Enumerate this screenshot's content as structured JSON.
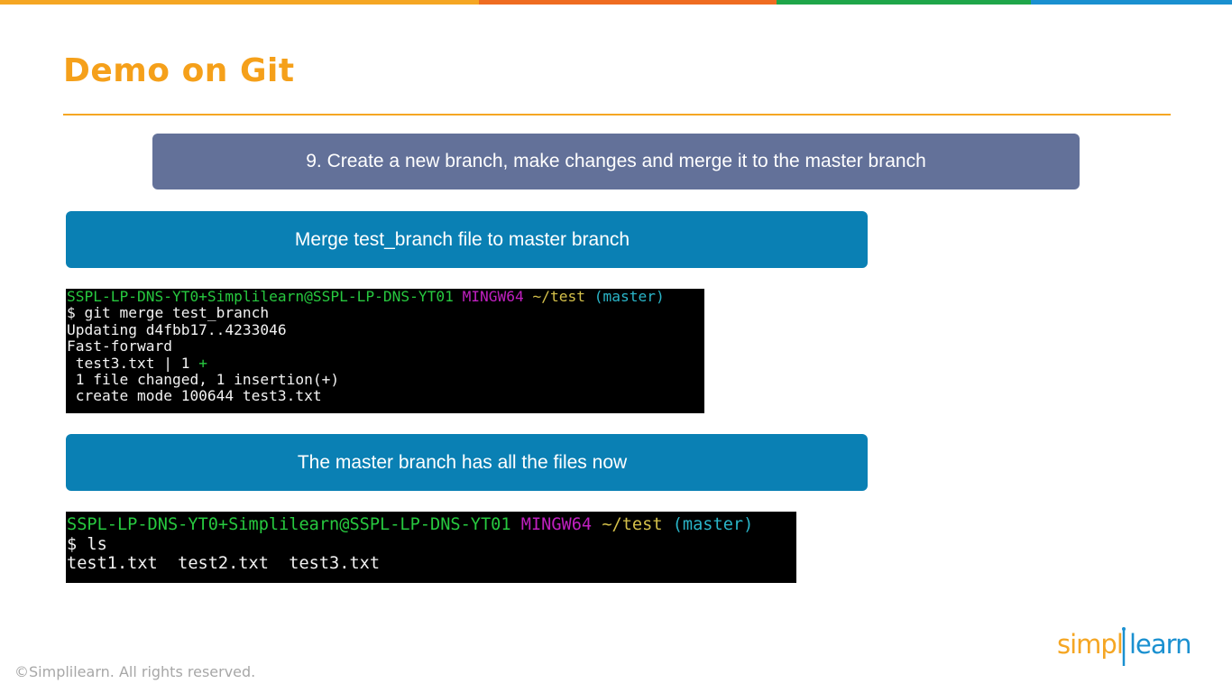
{
  "slide": {
    "title": "Demo on Git",
    "step_banner": "9. Create a new branch, make changes and merge it to the master branch",
    "merge_banner": "Merge test_branch file to master branch",
    "files_banner": "The master branch has all the files now"
  },
  "terminal_merge": {
    "prompt": {
      "user_host": "SSPL-LP-DNS-YT0+Simplilearn@SSPL-LP-DNS-YT01",
      "env": "MINGW64",
      "path": "~/test",
      "branch": "(master)"
    },
    "command": "$ git merge test_branch",
    "output": {
      "updating": "Updating d4fbb17..4233046",
      "fast_forward": "Fast-forward",
      "stat_file": " test3.txt | 1 ",
      "stat_plus": "+",
      "summary": " 1 file changed, 1 insertion(+)",
      "create": " create mode 100644 test3.txt"
    }
  },
  "terminal_ls": {
    "prompt": {
      "user_host": "SSPL-LP-DNS-YT0+Simplilearn@SSPL-LP-DNS-YT01",
      "env": "MINGW64",
      "path": "~/test",
      "branch": "(master)"
    },
    "command": "$ ls",
    "output": "test1.txt  test2.txt  test3.txt"
  },
  "footer": {
    "copyright": "©Simplilearn. All rights reserved."
  },
  "logo": {
    "part1": "simpl",
    "part2": "learn"
  },
  "colors": {
    "title": "#f5a01a",
    "step_banner": "#637199",
    "sub_banner": "#0a80b4",
    "terminal_green": "#27c93f",
    "terminal_magenta": "#c020c0",
    "terminal_yellow": "#c9b23a",
    "terminal_cyan": "#2ab5c8",
    "topbar": [
      "#f5a623",
      "#ef6c21",
      "#1fa64a",
      "#1a90d0"
    ]
  }
}
